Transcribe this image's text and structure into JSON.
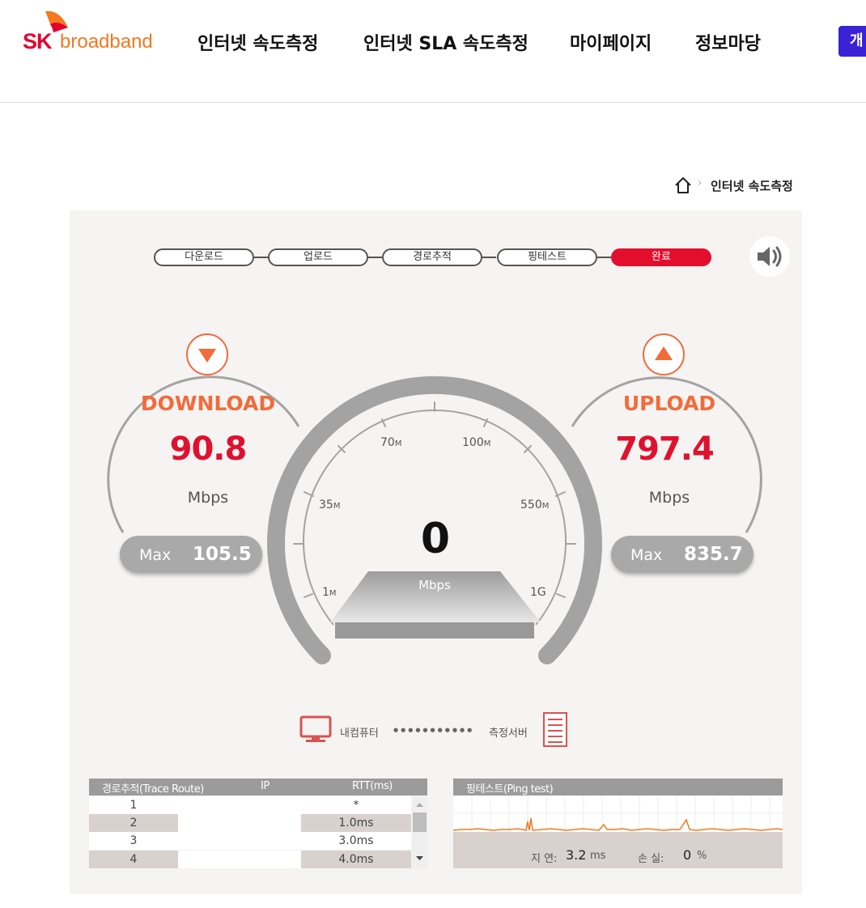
{
  "brand": {
    "sk": "SK",
    "name": "broadband"
  },
  "nav": [
    {
      "label": "인터넷 속도측정"
    },
    {
      "label": "인터넷 SLA 속도측정"
    },
    {
      "label": "마이페이지"
    },
    {
      "label": "정보마당"
    }
  ],
  "corner_button": {
    "label": "개"
  },
  "breadcrumb": {
    "current": "인터넷 속도측정"
  },
  "steps": [
    {
      "label": "다운로드",
      "active": false
    },
    {
      "label": "업로드",
      "active": false
    },
    {
      "label": "경로추적",
      "active": false
    },
    {
      "label": "핑테스트",
      "active": false
    },
    {
      "label": "완료",
      "active": true
    }
  ],
  "download": {
    "label": "DOWNLOAD",
    "value": "90.8",
    "unit": "Mbps",
    "max_label": "Max",
    "max_value": "105.5"
  },
  "upload": {
    "label": "UPLOAD",
    "value": "797.4",
    "unit": "Mbps",
    "max_label": "Max",
    "max_value": "835.7"
  },
  "speedometer": {
    "value": "0",
    "unit": "Mbps",
    "ticks": [
      {
        "num": "1",
        "suffix": "M"
      },
      {
        "num": "35",
        "suffix": "M"
      },
      {
        "num": "70",
        "suffix": "M"
      },
      {
        "num": "100",
        "suffix": "M"
      },
      {
        "num": "550",
        "suffix": "M"
      },
      {
        "num": "1G",
        "suffix": ""
      }
    ]
  },
  "connection": {
    "left": "내컴퓨터",
    "dots": "●●●●●●●●●●●",
    "right": "측정서버"
  },
  "trace": {
    "title": "경로추적(Trace Route)",
    "col_ip": "IP",
    "col_rtt": "RTT(ms)",
    "rows": [
      {
        "hop": "1",
        "rtt": "*"
      },
      {
        "hop": "2",
        "rtt": "1.0ms"
      },
      {
        "hop": "3",
        "rtt": "3.0ms"
      },
      {
        "hop": "4",
        "rtt": "4.0ms"
      }
    ]
  },
  "ping": {
    "title": "핑테스트(Ping test)",
    "latency_label": "지 연:",
    "latency_value": "3.2",
    "latency_unit": "ms",
    "loss_label": "손 실:",
    "loss_value": "0",
    "loss_unit": "%"
  },
  "colors": {
    "brand_red": "#e30e2c",
    "brand_orange": "#f47920",
    "accent_blue": "#3b22d6",
    "gauge_gray": "#a3a3a3"
  }
}
